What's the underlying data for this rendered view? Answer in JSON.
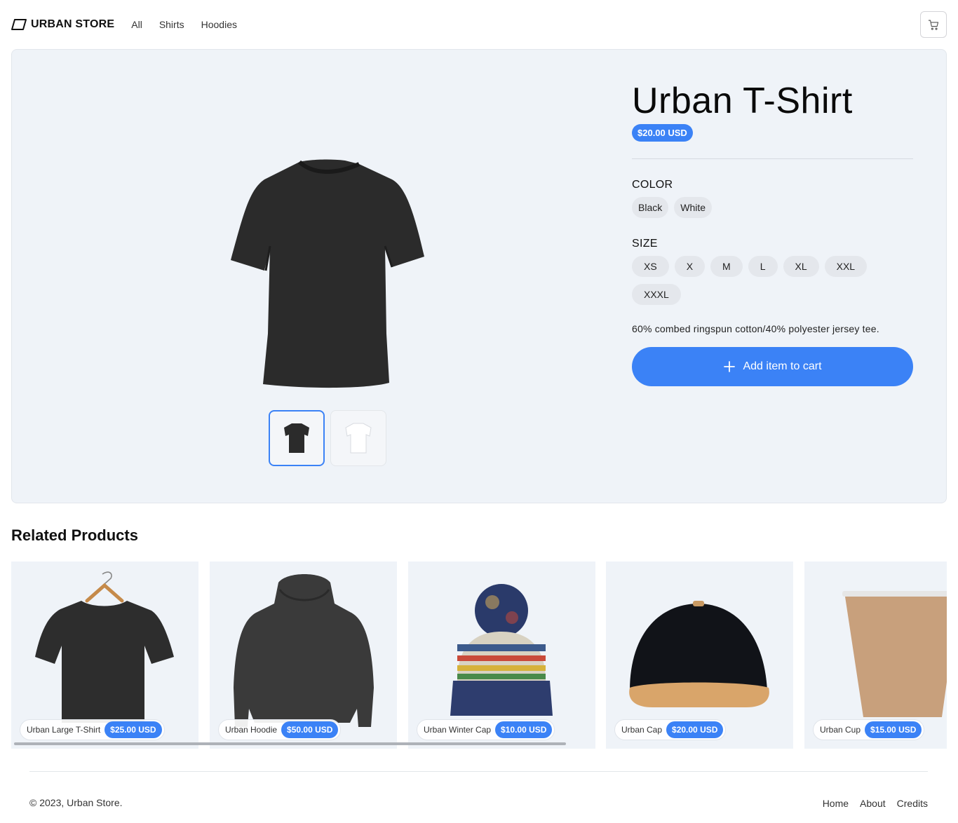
{
  "header": {
    "brand": "URBAN STORE",
    "nav": [
      "All",
      "Shirts",
      "Hoodies"
    ]
  },
  "product": {
    "title": "Urban T-Shirt",
    "price": "$20.00 USD",
    "color_label": "COLOR",
    "colors": [
      "Black",
      "White"
    ],
    "size_label": "SIZE",
    "sizes": [
      "XS",
      "X",
      "M",
      "L",
      "XL",
      "XXL",
      "XXXL"
    ],
    "description": "60% combed ringspun cotton/40% polyester jersey tee.",
    "add_to_cart": "Add item to cart"
  },
  "related": {
    "title": "Related Products",
    "items": [
      {
        "name": "Urban Large T-Shirt",
        "price": "$25.00 USD"
      },
      {
        "name": "Urban Hoodie",
        "price": "$50.00 USD"
      },
      {
        "name": "Urban Winter Cap",
        "price": "$10.00 USD"
      },
      {
        "name": "Urban Cap",
        "price": "$20.00 USD"
      },
      {
        "name": "Urban Cup",
        "price": "$15.00 USD"
      }
    ]
  },
  "footer": {
    "copyright": "© 2023, Urban Store.",
    "links": [
      "Home",
      "About",
      "Credits"
    ]
  },
  "colors": {
    "accent": "#3b82f6",
    "panel_bg": "#eff3f8",
    "chip_bg": "#e4e7ec"
  }
}
